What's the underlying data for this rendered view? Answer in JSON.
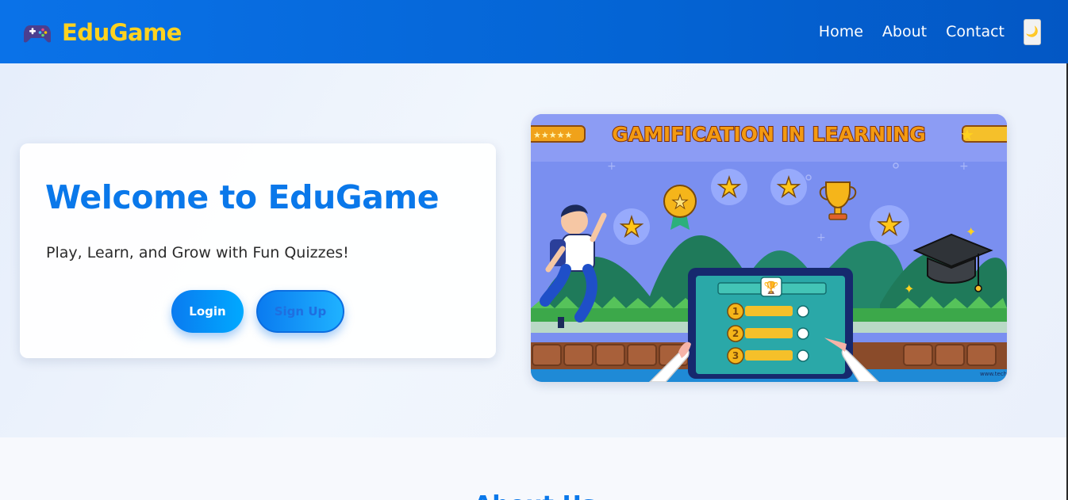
{
  "navbar": {
    "brand_icon": "gamepad-icon",
    "brand_name": "EduGame",
    "links": [
      "Home",
      "About",
      "Contact"
    ],
    "theme_toggle_icon": "moon-icon",
    "theme_toggle_glyph": "🌙"
  },
  "hero": {
    "title": "Welcome to EduGame",
    "subtitle": "Play, Learn, and Grow with Fun Quizzes!",
    "login_label": "Login",
    "signup_label": "Sign Up",
    "image_banner_text": "GAMIFICATION IN LEARNING",
    "image_watermark": "www.techv"
  },
  "about": {
    "title": "About Us"
  },
  "colors": {
    "nav_bg": "#0a72e8",
    "brand_yellow": "#ffd21f",
    "accent_blue": "#0a78ea"
  }
}
